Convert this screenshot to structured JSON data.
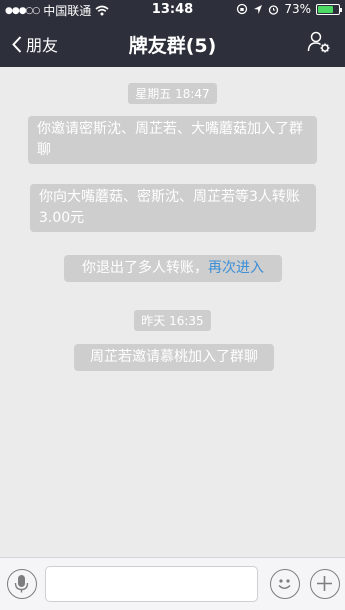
{
  "status_bar": {
    "signal_dots": "●●●○○",
    "carrier": "中国联通",
    "wifi_icon": "wifi-icon",
    "time": "13:48",
    "battery_percent": "73%",
    "battery_level": 0.73
  },
  "nav": {
    "back_label": "朋友",
    "title": "牌友群(5)"
  },
  "messages": {
    "time1": "星期五 18:47",
    "sys1": "你邀请密斯沈、周芷若、大嘴蘑菇加入了群聊",
    "sys2": "你向大嘴蘑菇、密斯沈、周芷若等3人转账3.00元",
    "sys3_text": "你退出了多人转账，",
    "sys3_link": "再次进入",
    "time2": "昨天 16:35",
    "sys4": "周芷若邀请慕桃加入了群聊"
  },
  "colors": {
    "nav_bg": "#2d2f3a",
    "chat_bg": "#ebebeb",
    "link": "#3c8fd8",
    "battery": "#4cd964"
  }
}
